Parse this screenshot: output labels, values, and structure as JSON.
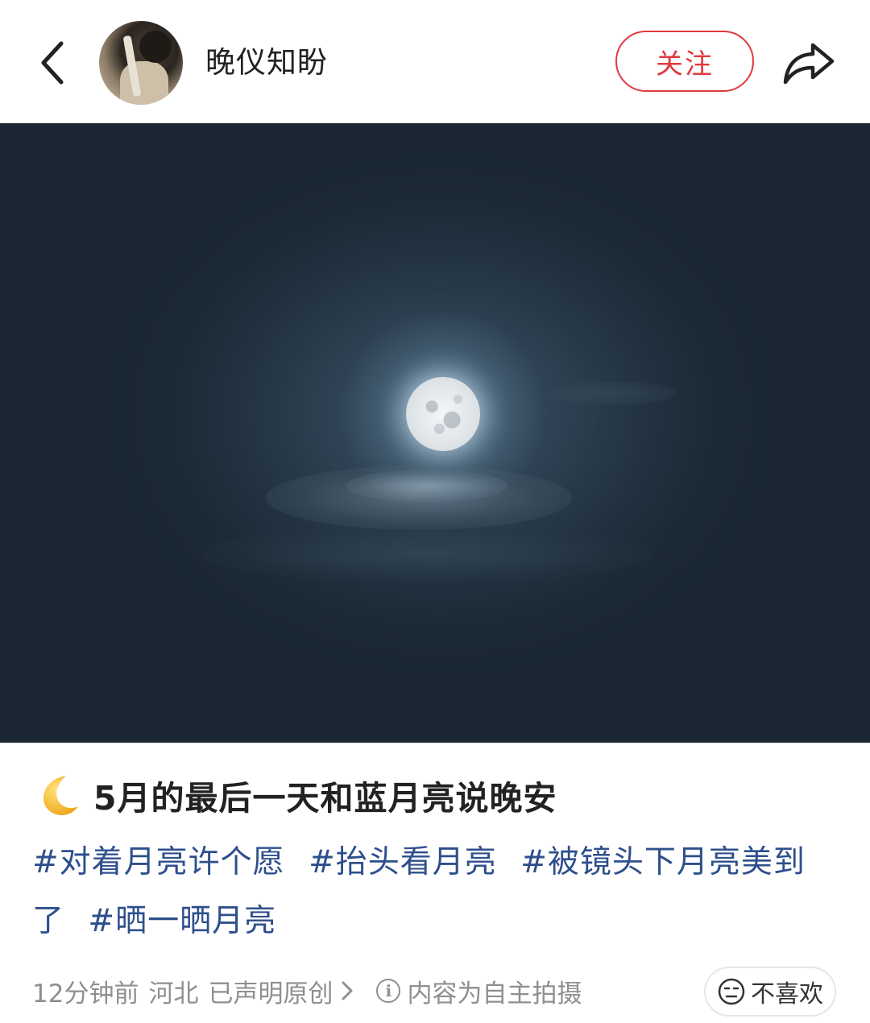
{
  "header": {
    "username": "晚仪知盼",
    "follow_label": "关注"
  },
  "post": {
    "title": "5月的最后一天和蓝月亮说晚安",
    "title_emoji": "crescent-moon-icon",
    "tags": [
      "#对着月亮许个愿",
      "#抬头看月亮",
      "#被镜头下月亮美到了",
      "#晒一晒月亮"
    ],
    "meta": {
      "time": "12分钟前",
      "location": "河北",
      "original": "已声明原创",
      "notice": "内容为自主拍摄"
    },
    "dislike_label": "不喜欢"
  },
  "colors": {
    "follow_accent": "#e0393e",
    "tag_color": "#2e4f8c",
    "meta_gray": "#8f8f8f"
  }
}
